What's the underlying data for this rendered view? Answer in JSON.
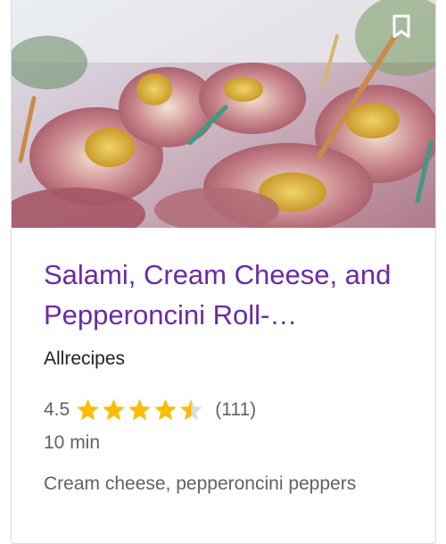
{
  "card": {
    "title": "Salami, Cream Cheese, and Pepperoncini Roll-…",
    "source": "Allrecipes",
    "rating": "4.5",
    "rating_fraction": 0.9,
    "review_count": "(111)",
    "time": "10 min",
    "ingredients": "Cream cheese, pepperoncini peppers",
    "image_icon": "recipe-photo",
    "bookmark_icon": "bookmark-icon",
    "colors": {
      "title": "#6a2aa8",
      "star": "#fbbc04",
      "star_empty": "#dadce0",
      "text_secondary": "#5f6368"
    }
  }
}
